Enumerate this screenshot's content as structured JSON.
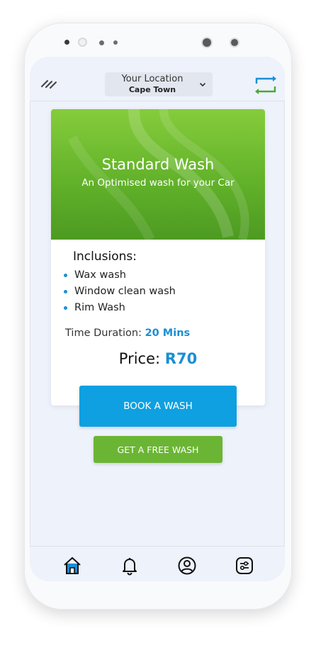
{
  "header": {
    "location_label": "Your Location",
    "location_value": "Cape Town",
    "menu_icon": "menu-icon",
    "sync_icon": "sync-icon"
  },
  "card": {
    "title": "Standard Wash",
    "subtitle": "An Optimised wash for your Car",
    "inclusions_title": "Inclusions:",
    "inclusions": [
      "Wax wash",
      "Window clean wash",
      "Rim Wash"
    ],
    "duration_label": "Time Duration:",
    "duration_value": "20 Mins",
    "price_label": "Price:",
    "price_value": "R70"
  },
  "actions": {
    "book_label": "BOOK A WASH",
    "free_label": "GET A FREE WASH"
  },
  "tabbar": {
    "items": [
      "home-icon",
      "bell-icon",
      "profile-icon",
      "settings-icon"
    ],
    "active": "home-icon"
  },
  "colors": {
    "accent_blue": "#1a8fd4",
    "button_blue": "#0ea0e0",
    "green": "#6bb534"
  }
}
